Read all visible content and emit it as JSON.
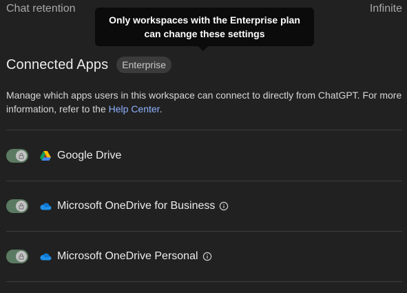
{
  "chat_retention": {
    "label": "Chat retention",
    "value": "Infinite"
  },
  "tooltip": {
    "text": "Only workspaces with the Enterprise plan can change these settings"
  },
  "connected_apps": {
    "title": "Connected Apps",
    "badge": "Enterprise",
    "description_prefix": "Manage which apps users in this workspace can connect to directly from ChatGPT. For more information, refer to the ",
    "help_link": "Help Center",
    "description_suffix": ".",
    "apps": [
      {
        "name": "Google Drive",
        "enabled": true,
        "locked": true,
        "icon": "google-drive-icon",
        "has_info": false
      },
      {
        "name": "Microsoft OneDrive for Business",
        "enabled": true,
        "locked": true,
        "icon": "onedrive-icon",
        "has_info": true
      },
      {
        "name": "Microsoft OneDrive Personal",
        "enabled": true,
        "locked": true,
        "icon": "onedrive-icon",
        "has_info": true
      }
    ]
  },
  "colors": {
    "background": "#212121",
    "toggle_on": "#5b7a62",
    "link": "#8fb1ff"
  }
}
